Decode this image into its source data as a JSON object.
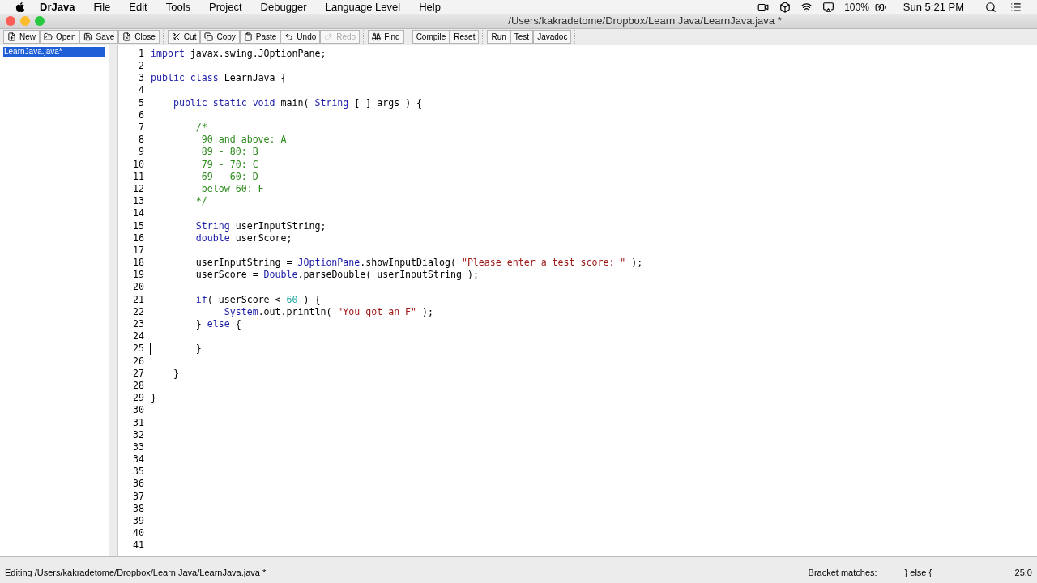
{
  "menu_bar": {
    "app": "DrJava",
    "items": [
      "File",
      "Edit",
      "Tools",
      "Project",
      "Debugger",
      "Language Level",
      "Help"
    ],
    "battery": "100%",
    "clock": "Sun 5:21 PM"
  },
  "window": {
    "title": "/Users/kakradetome/Dropbox/Learn Java/LearnJava.java *"
  },
  "toolbar": {
    "groups": [
      [
        {
          "label": "New",
          "disabled": false
        },
        {
          "label": "Open",
          "disabled": false
        },
        {
          "label": "Save",
          "disabled": false
        },
        {
          "label": "Close",
          "disabled": false
        }
      ],
      [
        {
          "label": "Cut",
          "disabled": false
        },
        {
          "label": "Copy",
          "disabled": false
        },
        {
          "label": "Paste",
          "disabled": false
        },
        {
          "label": "Undo",
          "disabled": false
        },
        {
          "label": "Redo",
          "disabled": true
        }
      ],
      [
        {
          "label": "Find",
          "disabled": false
        }
      ],
      [
        {
          "label": "Compile",
          "disabled": false
        },
        {
          "label": "Reset",
          "disabled": false
        }
      ],
      [
        {
          "label": "Run",
          "disabled": false
        },
        {
          "label": "Test",
          "disabled": false
        },
        {
          "label": "Javadoc",
          "disabled": false
        }
      ]
    ]
  },
  "documents": [
    {
      "name": "LearnJava.java*",
      "selected": true
    }
  ],
  "editor": {
    "lines": [
      {
        "number": "1",
        "tokens": [
          {
            "kind": "keyword",
            "text": "import"
          },
          {
            "kind": "plain",
            "text": " javax.swing.JOptionPane;"
          }
        ]
      },
      {
        "number": "2"
      },
      {
        "number": "3",
        "tokens": [
          {
            "kind": "keyword",
            "text": "public class"
          },
          {
            "kind": "plain",
            "text": " LearnJava {"
          }
        ]
      },
      {
        "number": "4"
      },
      {
        "number": "5",
        "tokens": [
          {
            "kind": "keyword",
            "text": "    public static void"
          },
          {
            "kind": "plain",
            "text": " main( "
          },
          {
            "kind": "keyword",
            "text": "String"
          },
          {
            "kind": "plain",
            "text": " [ ] args ) {"
          }
        ]
      },
      {
        "number": "6"
      },
      {
        "number": "7",
        "tokens": [
          {
            "kind": "comment",
            "text": "        /*"
          }
        ]
      },
      {
        "number": "8",
        "tokens": [
          {
            "kind": "comment",
            "text": "         90 and above: A"
          }
        ]
      },
      {
        "number": "9",
        "tokens": [
          {
            "kind": "comment",
            "text": "         89 - 80: B"
          }
        ]
      },
      {
        "number": "10",
        "tokens": [
          {
            "kind": "comment",
            "text": "         79 - 70: C"
          }
        ]
      },
      {
        "number": "11",
        "tokens": [
          {
            "kind": "comment",
            "text": "         69 - 60: D"
          }
        ]
      },
      {
        "number": "12",
        "tokens": [
          {
            "kind": "comment",
            "text": "         below 60: F"
          }
        ]
      },
      {
        "number": "13",
        "tokens": [
          {
            "kind": "comment",
            "text": "        */"
          }
        ]
      },
      {
        "number": "14"
      },
      {
        "number": "15",
        "tokens": [
          {
            "kind": "keyword",
            "text": "        String"
          },
          {
            "kind": "plain",
            "text": " userInputString;"
          }
        ]
      },
      {
        "number": "16",
        "tokens": [
          {
            "kind": "keyword",
            "text": "        double"
          },
          {
            "kind": "plain",
            "text": " userScore;"
          }
        ]
      },
      {
        "number": "17"
      },
      {
        "number": "18",
        "tokens": [
          {
            "kind": "plain",
            "text": "        userInputString = "
          },
          {
            "kind": "keyword",
            "text": "JOptionPane"
          },
          {
            "kind": "plain",
            "text": ".showInputDialog( "
          },
          {
            "kind": "string",
            "text": "\"Please enter a test score: \""
          },
          {
            "kind": "plain",
            "text": " );"
          }
        ]
      },
      {
        "number": "19",
        "tokens": [
          {
            "kind": "plain",
            "text": "        userScore = "
          },
          {
            "kind": "keyword",
            "text": "Double"
          },
          {
            "kind": "plain",
            "text": ".parseDouble( userInputString );"
          }
        ]
      },
      {
        "number": "20"
      },
      {
        "number": "21",
        "tokens": [
          {
            "kind": "keyword",
            "text": "        if"
          },
          {
            "kind": "plain",
            "text": "( userScore < "
          },
          {
            "kind": "number",
            "text": "60"
          },
          {
            "kind": "plain",
            "text": " ) {"
          }
        ]
      },
      {
        "number": "22",
        "tokens": [
          {
            "kind": "keyword",
            "text": "             System"
          },
          {
            "kind": "plain",
            "text": ".out.println( "
          },
          {
            "kind": "string",
            "text": "\"You got an F\""
          },
          {
            "kind": "plain",
            "text": " );"
          }
        ]
      },
      {
        "number": "23",
        "tokens": [
          {
            "kind": "plain",
            "text": "        } "
          },
          {
            "kind": "keyword",
            "text": "else"
          },
          {
            "kind": "plain",
            "text": " {"
          }
        ]
      },
      {
        "number": "24"
      },
      {
        "number": "25",
        "caret": true,
        "tokens": [
          {
            "kind": "plain",
            "text": "        }"
          }
        ]
      },
      {
        "number": "26"
      },
      {
        "number": "27",
        "tokens": [
          {
            "kind": "plain",
            "text": "    }"
          }
        ]
      },
      {
        "number": "28"
      },
      {
        "number": "29",
        "tokens": [
          {
            "kind": "plain",
            "text": "}"
          }
        ]
      },
      {
        "number": "30"
      },
      {
        "number": "31"
      },
      {
        "number": "32"
      },
      {
        "number": "33"
      },
      {
        "number": "34"
      },
      {
        "number": "35"
      },
      {
        "number": "36"
      },
      {
        "number": "37"
      },
      {
        "number": "38"
      },
      {
        "number": "39"
      },
      {
        "number": "40"
      },
      {
        "number": "41"
      }
    ]
  },
  "status_bar": {
    "message": "Editing /Users/kakradetome/Dropbox/Learn Java/LearnJava.java *",
    "bracket_label": "Bracket matches:",
    "bracket_value": "} else {",
    "position": "25:0"
  }
}
